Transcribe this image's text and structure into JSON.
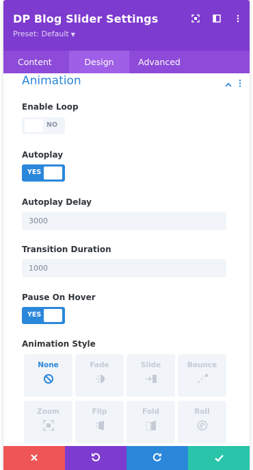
{
  "header": {
    "title": "DP Blog Slider Settings",
    "preset": "Preset: Default"
  },
  "tabs": [
    {
      "label": "Content",
      "active": false
    },
    {
      "label": "Design",
      "active": true
    },
    {
      "label": "Advanced",
      "active": false
    }
  ],
  "section": {
    "title": "Animation"
  },
  "fields": {
    "enable_loop": {
      "label": "Enable Loop",
      "state": "NO"
    },
    "autoplay": {
      "label": "Autoplay",
      "state": "YES"
    },
    "autoplay_delay": {
      "label": "Autoplay Delay",
      "value": "3000"
    },
    "transition_duration": {
      "label": "Transition Duration",
      "value": "1000"
    },
    "pause_on_hover": {
      "label": "Pause On Hover",
      "state": "YES"
    },
    "animation_style": {
      "label": "Animation Style",
      "options": [
        {
          "name": "None",
          "icon": "none-icon",
          "selected": true
        },
        {
          "name": "Fade",
          "icon": "fade-icon"
        },
        {
          "name": "Slide",
          "icon": "slide-icon"
        },
        {
          "name": "Bounce",
          "icon": "bounce-icon"
        },
        {
          "name": "Zoom",
          "icon": "zoom-icon"
        },
        {
          "name": "Flip",
          "icon": "flip-icon"
        },
        {
          "name": "Fold",
          "icon": "fold-icon"
        },
        {
          "name": "Roll",
          "icon": "roll-icon"
        }
      ]
    }
  },
  "footer": {
    "buttons": [
      {
        "name": "discard",
        "icon": "close-icon",
        "color": "#ef5555"
      },
      {
        "name": "undo",
        "icon": "undo-icon",
        "color": "#7d3bcf"
      },
      {
        "name": "redo",
        "icon": "redo-icon",
        "color": "#2b87da"
      },
      {
        "name": "save",
        "icon": "check-icon",
        "color": "#29c4a9"
      }
    ]
  },
  "colors": {
    "header": "#7d3bcf",
    "tabs": "#8e4ad8",
    "accent": "#2b87da",
    "field_bg": "#f1f5f9"
  }
}
